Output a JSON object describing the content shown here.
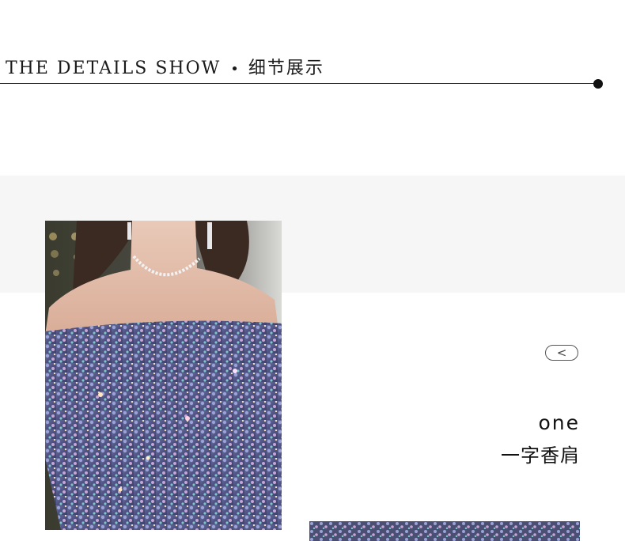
{
  "header": {
    "title_en": "THE DETAILS SHOW",
    "separator": "•",
    "title_zh": "细节展示"
  },
  "detail": {
    "nav_icon": "chevron-left-icon",
    "nav_glyph": "<",
    "caption_en": "one",
    "caption_zh": "一字香肩"
  },
  "colors": {
    "band": "#f6f6f6",
    "text": "#111111",
    "sequin_base": "#5b5f8c"
  }
}
